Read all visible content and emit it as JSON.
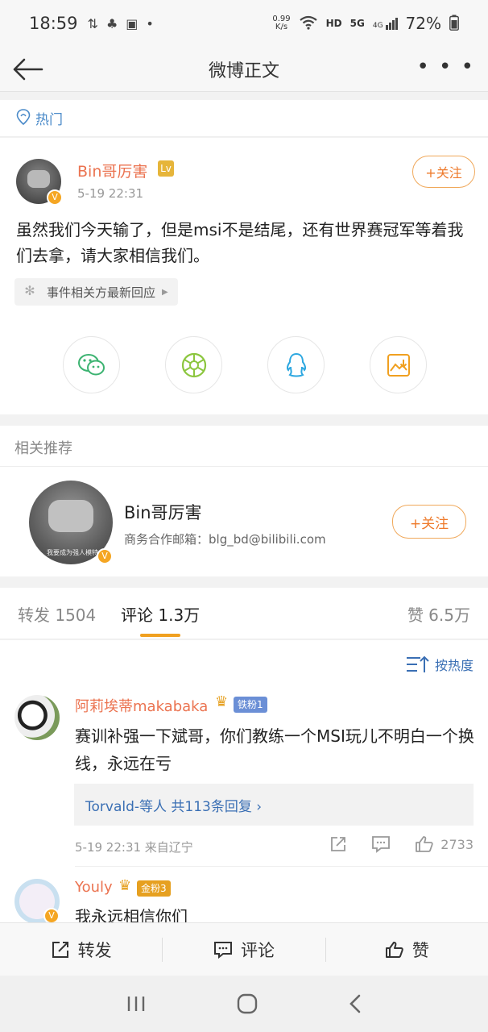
{
  "status_bar": {
    "time": "18:59",
    "net_speed_value": "0.99",
    "net_speed_unit": "K/s",
    "hd": "HD",
    "sig_5g": "5G",
    "sig_4g": "4G",
    "battery": "72%"
  },
  "nav": {
    "title": "微博正文",
    "more": "• • •"
  },
  "hot": {
    "label": "热门"
  },
  "post": {
    "author": "Bin哥厉害",
    "level_glyph": "Lv",
    "time": "5-19 22:31",
    "follow": "+关注",
    "content": "虽然我们今天输了，但是msi不是结尾，还有世界赛冠军等着我们去拿，请大家相信我们。",
    "topic": "事件相关方最新回应",
    "share": [
      "wechat",
      "moments",
      "qq",
      "save-image"
    ]
  },
  "recommend": {
    "title": "相关推荐",
    "name": "Bin哥厉害",
    "desc": "商务合作邮箱：blg_bd@bilibili.com",
    "follow": "+关注",
    "avatar_caption": "我要成为强人模特"
  },
  "tabs": {
    "repost": "转发 1504",
    "comment": "评论 1.3万",
    "like": "赞 6.5万"
  },
  "comments": {
    "sort": "按热度",
    "items": [
      {
        "name": "阿莉埃蒂makabaka",
        "badge": "铁粉1",
        "text": "赛训补强一下斌哥，你们教练一个MSI玩儿不明白一个换线，永远在亏",
        "replies": "Torvald-等人  共113条回复 ›",
        "meta": "5-19 22:31  来自辽宁",
        "likes": "2733"
      },
      {
        "name": "Youly",
        "badge": "金粉3",
        "text": "我永远相信你们"
      }
    ]
  },
  "bottom": {
    "repost": "转发",
    "comment": "评论",
    "like": "赞"
  },
  "colors": {
    "orange": "#eb7350",
    "blue": "#3a6fb4",
    "accent": "#f0a020"
  }
}
